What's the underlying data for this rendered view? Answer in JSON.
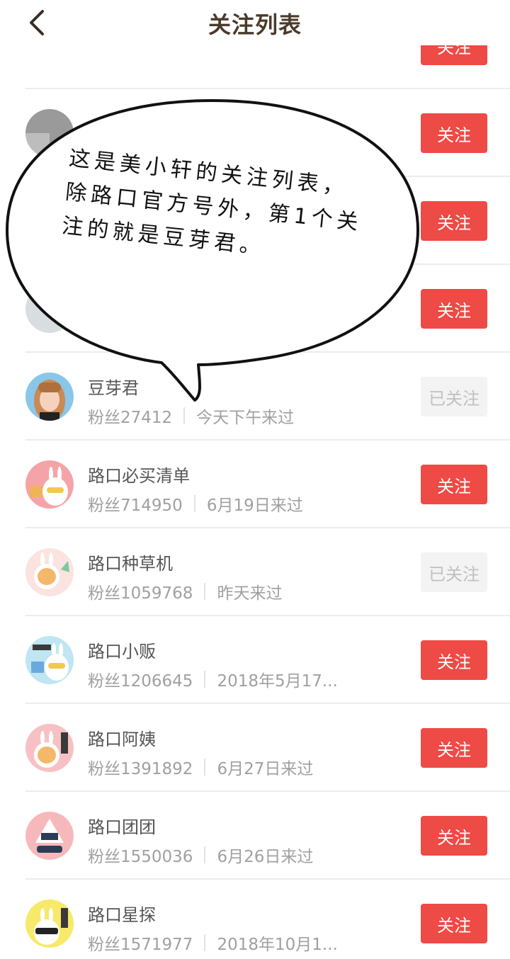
{
  "header": {
    "title": "关注列表"
  },
  "annotation": {
    "text": "这是美小轩的关注列表，除路口官方号外，第1个关注的就是豆芽君。"
  },
  "buttons": {
    "follow": "关注",
    "followed": "已关注"
  },
  "rows": [
    {
      "name": "",
      "fans": "",
      "visit": "",
      "status": "关注"
    },
    {
      "name": "",
      "fans": "",
      "visit": "",
      "status": "关注"
    },
    {
      "name": "",
      "fans": "",
      "visit": "",
      "status": "关注"
    },
    {
      "name": "",
      "fans": "",
      "visit": "",
      "status": "关注"
    },
    {
      "name": "豆芽君",
      "fans": "粉丝27412",
      "visit": "今天下午来过",
      "status": "已关注"
    },
    {
      "name": "路口必买清单",
      "fans": "粉丝714950",
      "visit": "6月19日来过",
      "status": "关注"
    },
    {
      "name": "路口种草机",
      "fans": "粉丝1059768",
      "visit": "昨天来过",
      "status": "已关注"
    },
    {
      "name": "路口小贩",
      "fans": "粉丝1206645",
      "visit": "2018年5月17...",
      "status": "关注"
    },
    {
      "name": "路口阿姨",
      "fans": "粉丝1391892",
      "visit": "6月27日来过",
      "status": "关注"
    },
    {
      "name": "路口团团",
      "fans": "粉丝1550036",
      "visit": "6月26日来过",
      "status": "关注"
    },
    {
      "name": "路口星探",
      "fans": "粉丝1571977",
      "visit": "2018年10月1...",
      "status": "关注"
    }
  ],
  "colors": {
    "accent": "#ee4a46",
    "followed_bg": "#f3f3f3",
    "title": "#4a3a2a"
  }
}
